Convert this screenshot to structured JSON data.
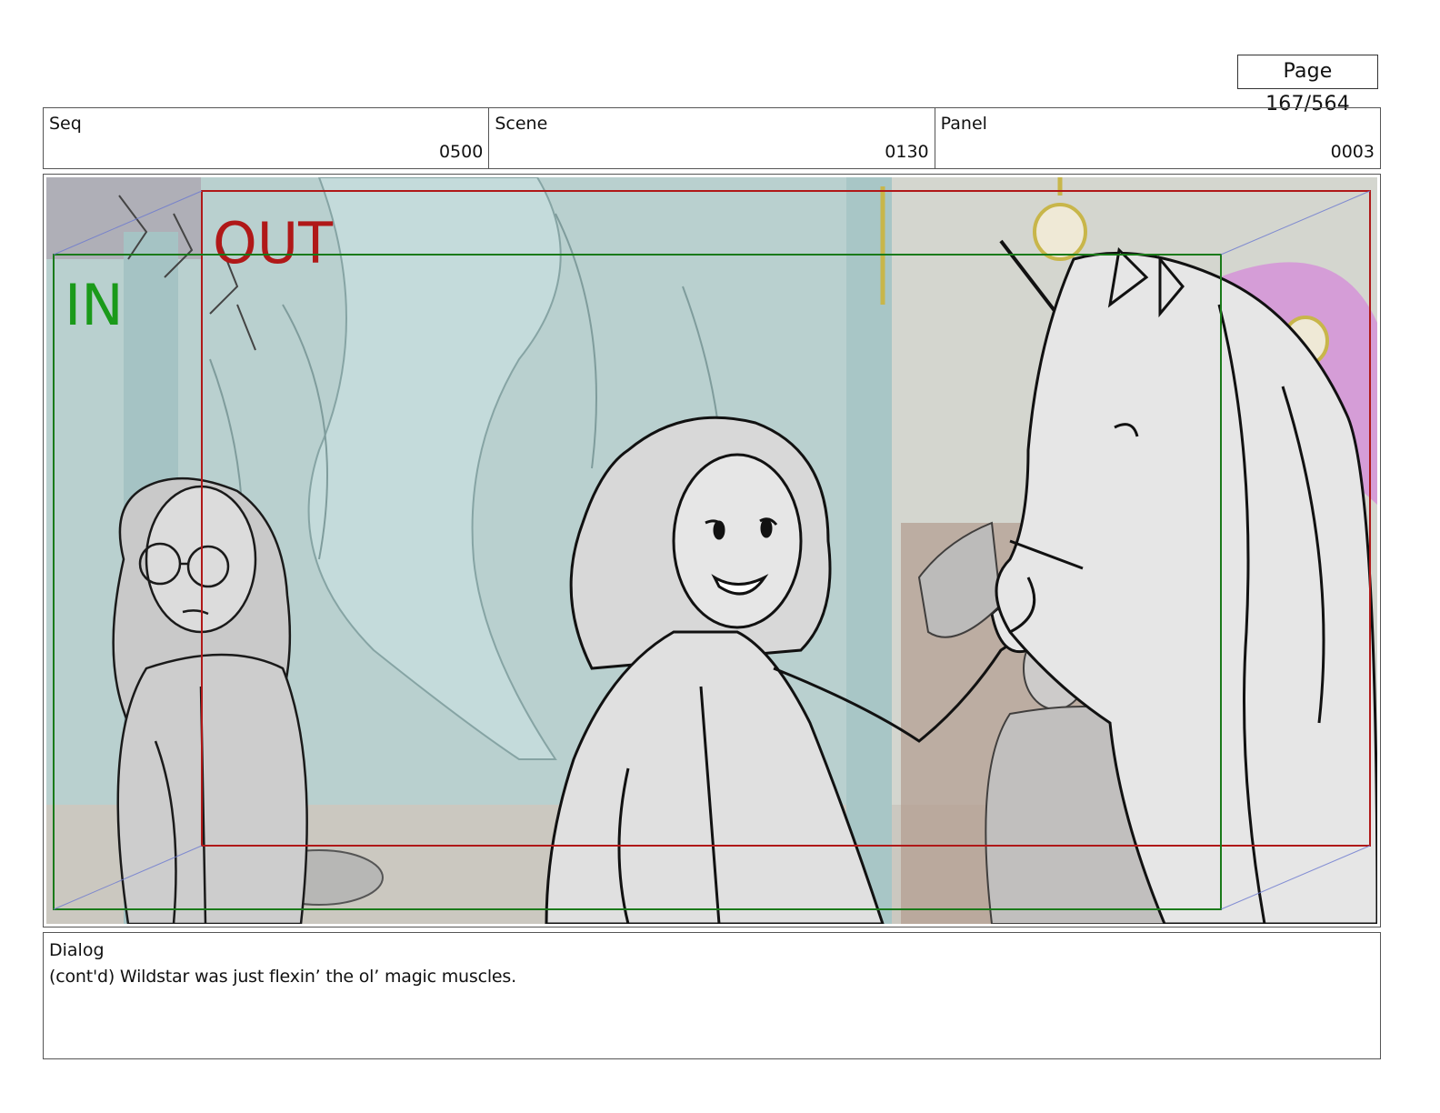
{
  "page": {
    "label": "Page 167/564"
  },
  "header": {
    "seq": {
      "label": "Seq",
      "value": "0500"
    },
    "scene": {
      "label": "Scene",
      "value": "0130"
    },
    "panel": {
      "label": "Panel",
      "value": "0003"
    }
  },
  "frame_guides": {
    "out_label": "OUT",
    "in_label": "IN",
    "out_color": "#b01818",
    "in_color": "#1a9a1a"
  },
  "dialog": {
    "label": "Dialog",
    "text": "(cont'd) Wildstar was just flexin’ the ol’ magic muscles."
  },
  "colors": {
    "background_teal": "#b8cfcf",
    "sketch_line": "#1a1a1a"
  }
}
